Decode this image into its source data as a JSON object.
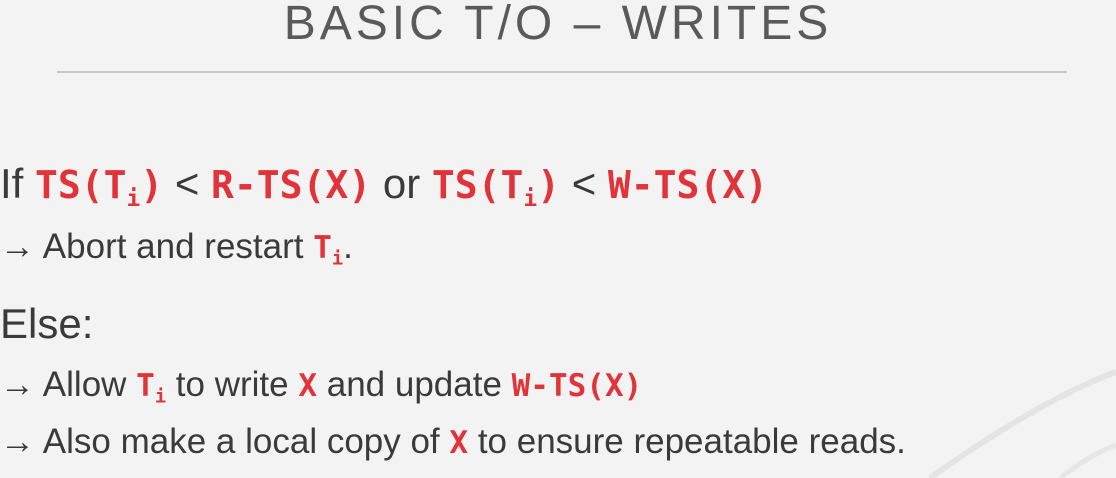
{
  "slide": {
    "title": "BASIC T/O – WRITES",
    "if_line": {
      "prefix": "If",
      "ts": "TS(T",
      "sub_i": "i",
      "close": ")",
      "lt": "<",
      "rts": "R-TS(X)",
      "or": "or",
      "ts2": "TS(T",
      "sub_i2": "i",
      "close2": ")",
      "lt2": "<",
      "wts": "W-TS(X)"
    },
    "abort_line": {
      "arrow": "→",
      "text": "Abort and restart",
      "t": "T",
      "sub_i": "i",
      "period": "."
    },
    "else_label": "Else:",
    "allow_line": {
      "arrow": "→",
      "text1": "Allow",
      "t": "T",
      "sub_i": "i",
      "text2": "to write",
      "x": "X",
      "text3": "and update",
      "wts": "W-TS(X)"
    },
    "copy_line": {
      "arrow": "→",
      "text1": "Also make a local copy of",
      "x": "X",
      "text2": "to ensure repeatable reads."
    }
  },
  "colors": {
    "background": "#f3f3f3",
    "text": "#3a3a3a",
    "highlight": "#e2333a",
    "rule": "#c9c9c9"
  }
}
